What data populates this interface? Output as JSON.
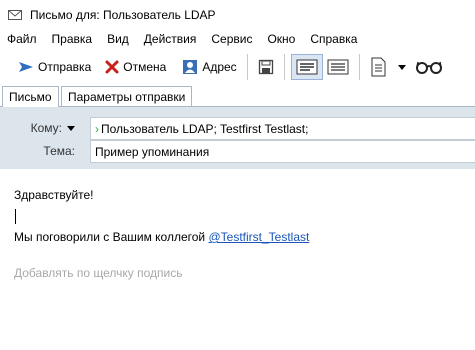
{
  "window": {
    "title": "Письмо для: Пользователь LDAP"
  },
  "menu": [
    "Файл",
    "Правка",
    "Вид",
    "Действия",
    "Сервис",
    "Окно",
    "Справка"
  ],
  "toolbar": {
    "send": "Отправка",
    "cancel": "Отмена",
    "address": "Адрес"
  },
  "tabs": {
    "message": "Письмо",
    "send_options": "Параметры отправки"
  },
  "headers": {
    "to_label": "Кому:",
    "to_value": "Пользователь LDAP;  Testfirst Testlast;",
    "subject_label": "Тема:",
    "subject_value": "Пример упоминания"
  },
  "body": {
    "greeting": "Здравствуйте!",
    "text": "Мы поговорили с Вашим коллегой ",
    "mention": "@Testfirst_Testlast",
    "signature_hint": "Добавлять по щелчку подпись"
  },
  "colors": {
    "header_bg": "#dde5ec",
    "mention": "#1a56b8",
    "cancel_red": "#c8211b",
    "check_green": "#2da84a"
  }
}
